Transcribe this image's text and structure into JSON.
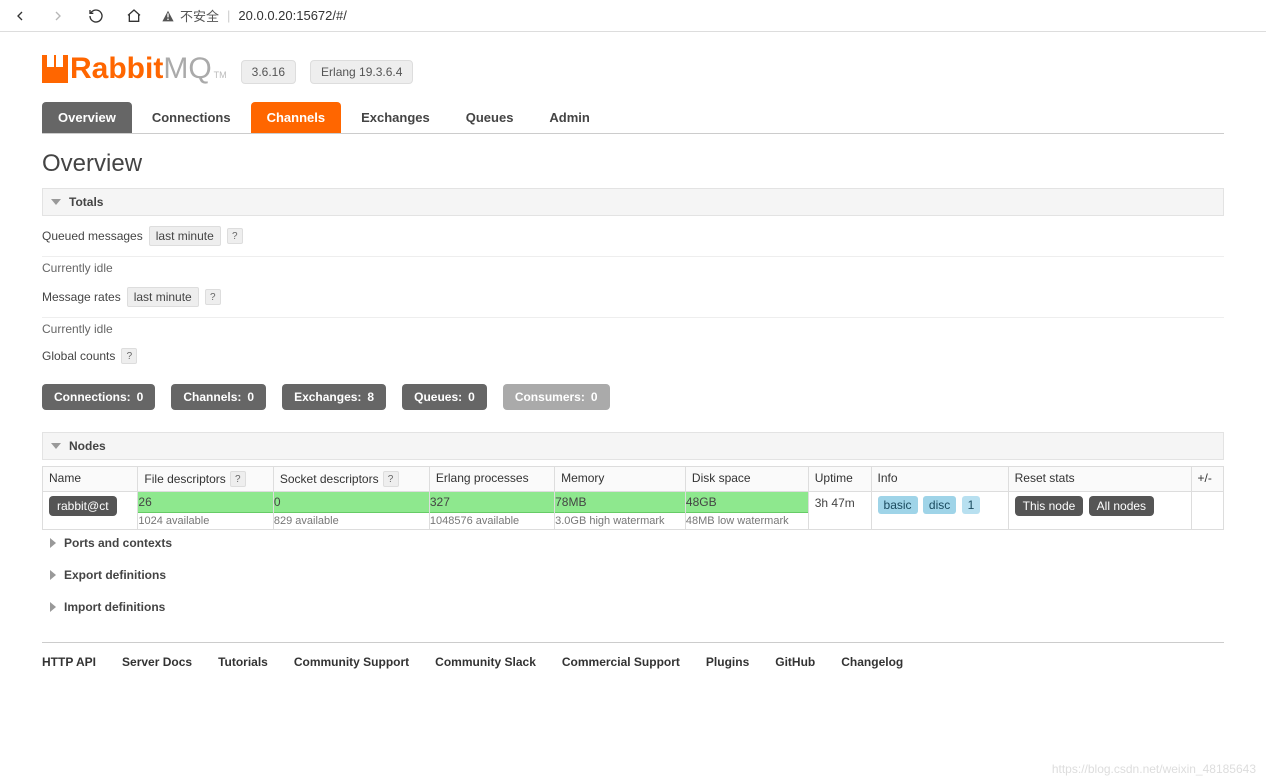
{
  "browser": {
    "insecure_label": "不安全",
    "url_display": "20.0.0.20:15672/#/"
  },
  "logo": {
    "brand_left": "Rabbit",
    "brand_right": "MQ",
    "tm": "TM"
  },
  "versions": {
    "app": "3.6.16",
    "erlang": "Erlang 19.3.6.4"
  },
  "tabs": [
    {
      "label": "Overview",
      "state": "active"
    },
    {
      "label": "Connections",
      "state": "plain"
    },
    {
      "label": "Channels",
      "state": "highlight"
    },
    {
      "label": "Exchanges",
      "state": "plain"
    },
    {
      "label": "Queues",
      "state": "plain"
    },
    {
      "label": "Admin",
      "state": "plain"
    }
  ],
  "page_title": "Overview",
  "sections": {
    "totals": "Totals",
    "nodes": "Nodes",
    "ports": "Ports and contexts",
    "export": "Export definitions",
    "import": "Import definitions"
  },
  "totals": {
    "queued_label": "Queued messages",
    "queued_dd": "last minute",
    "queued_idle": "Currently idle",
    "rates_label": "Message rates",
    "rates_dd": "last minute",
    "rates_idle": "Currently idle",
    "global_label": "Global counts"
  },
  "counts": {
    "connections_label": "Connections:",
    "connections_value": "0",
    "channels_label": "Channels:",
    "channels_value": "0",
    "exchanges_label": "Exchanges:",
    "exchanges_value": "8",
    "queues_label": "Queues:",
    "queues_value": "0",
    "consumers_label": "Consumers:",
    "consumers_value": "0"
  },
  "nodes_table": {
    "headers": {
      "name": "Name",
      "fd": "File descriptors",
      "sd": "Socket descriptors",
      "ep": "Erlang processes",
      "mem": "Memory",
      "disk": "Disk space",
      "uptime": "Uptime",
      "info": "Info",
      "reset": "Reset stats",
      "plus": "+/-"
    },
    "row": {
      "name": "rabbit@ct",
      "fd_val": "26",
      "fd_sub": "1024 available",
      "sd_val": "0",
      "sd_sub": "829 available",
      "ep_val": "327",
      "ep_sub": "1048576 available",
      "mem_val": "78MB",
      "mem_sub": "3.0GB high watermark",
      "disk_val": "48GB",
      "disk_sub": "48MB low watermark",
      "uptime": "3h 47m",
      "info_basic": "basic",
      "info_disc": "disc",
      "info_num": "1",
      "reset_this": "This node",
      "reset_all": "All nodes"
    }
  },
  "footer": [
    "HTTP API",
    "Server Docs",
    "Tutorials",
    "Community Support",
    "Community Slack",
    "Commercial Support",
    "Plugins",
    "GitHub",
    "Changelog"
  ],
  "watermark": "https://blog.csdn.net/weixin_48185643",
  "help_char": "?"
}
